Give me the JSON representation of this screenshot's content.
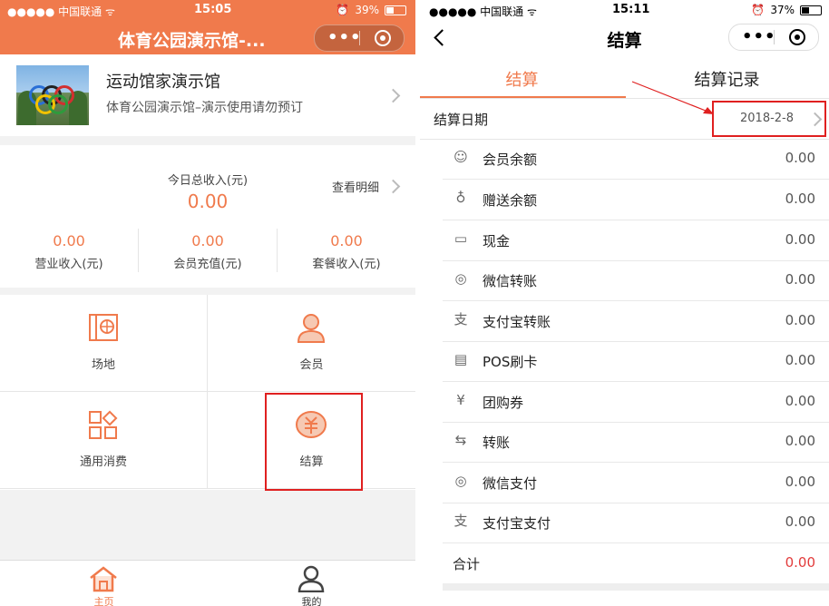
{
  "left": {
    "status": {
      "carrier": "●●●●● 中国联通 ᯤ",
      "time": "15:05",
      "battery": "39%"
    },
    "nav": {
      "title": "体育公园演示馆-...",
      "more_glyph": "•••"
    },
    "venue": {
      "name": "运动馆家演示馆",
      "subtitle": "体育公园演示馆–演示使用请勿预订"
    },
    "income": {
      "label": "今日总收入(元)",
      "total": "0.00",
      "detail_link": "查看明细",
      "stats": [
        {
          "value": "0.00",
          "label": "营业收入(元)"
        },
        {
          "value": "0.00",
          "label": "会员充值(元)"
        },
        {
          "value": "0.00",
          "label": "套餐收入(元)"
        }
      ]
    },
    "menu": [
      {
        "label": "场地",
        "icon": "court-icon"
      },
      {
        "label": "会员",
        "icon": "member-icon"
      },
      {
        "label": "通用消费",
        "icon": "general-consumption-icon"
      },
      {
        "label": "结算",
        "icon": "settlement-icon"
      }
    ],
    "tabbar": [
      {
        "label": "主页",
        "icon": "home-icon",
        "active": true
      },
      {
        "label": "我的",
        "icon": "profile-icon",
        "active": false
      }
    ],
    "accent": "#f07a4c",
    "highlight": "#e02020"
  },
  "right": {
    "status": {
      "carrier": "●●●●● 中国联通 ᯤ",
      "time": "15:11",
      "battery": "37%"
    },
    "nav": {
      "title": "结算",
      "more_glyph": "•••"
    },
    "tabs": [
      {
        "label": "结算",
        "active": true
      },
      {
        "label": "结算记录",
        "active": false
      }
    ],
    "date": {
      "label": "结算日期",
      "value": "2018-2-8"
    },
    "rows": [
      {
        "label": "会员余额",
        "value": "0.00",
        "icon": "member-balance-icon",
        "glyph": "☺"
      },
      {
        "label": "赠送余额",
        "value": "0.00",
        "icon": "gift-balance-icon",
        "glyph": "♁"
      },
      {
        "label": "现金",
        "value": "0.00",
        "icon": "wallet-icon",
        "glyph": "▭"
      },
      {
        "label": "微信转账",
        "value": "0.00",
        "icon": "wechat-icon",
        "glyph": "◎"
      },
      {
        "label": "支付宝转账",
        "value": "0.00",
        "icon": "alipay-icon",
        "glyph": "支"
      },
      {
        "label": "POS刷卡",
        "value": "0.00",
        "icon": "pos-icon",
        "glyph": "▤"
      },
      {
        "label": "团购券",
        "value": "0.00",
        "icon": "coupon-icon",
        "glyph": "¥"
      },
      {
        "label": "转账",
        "value": "0.00",
        "icon": "transfer-icon",
        "glyph": "⇆"
      },
      {
        "label": "微信支付",
        "value": "0.00",
        "icon": "wechat-pay-icon",
        "glyph": "◎"
      },
      {
        "label": "支付宝支付",
        "value": "0.00",
        "icon": "alipay-pay-icon",
        "glyph": "支"
      }
    ],
    "total": {
      "label": "合计",
      "value": "0.00"
    },
    "total_color": "#e23b3b"
  }
}
